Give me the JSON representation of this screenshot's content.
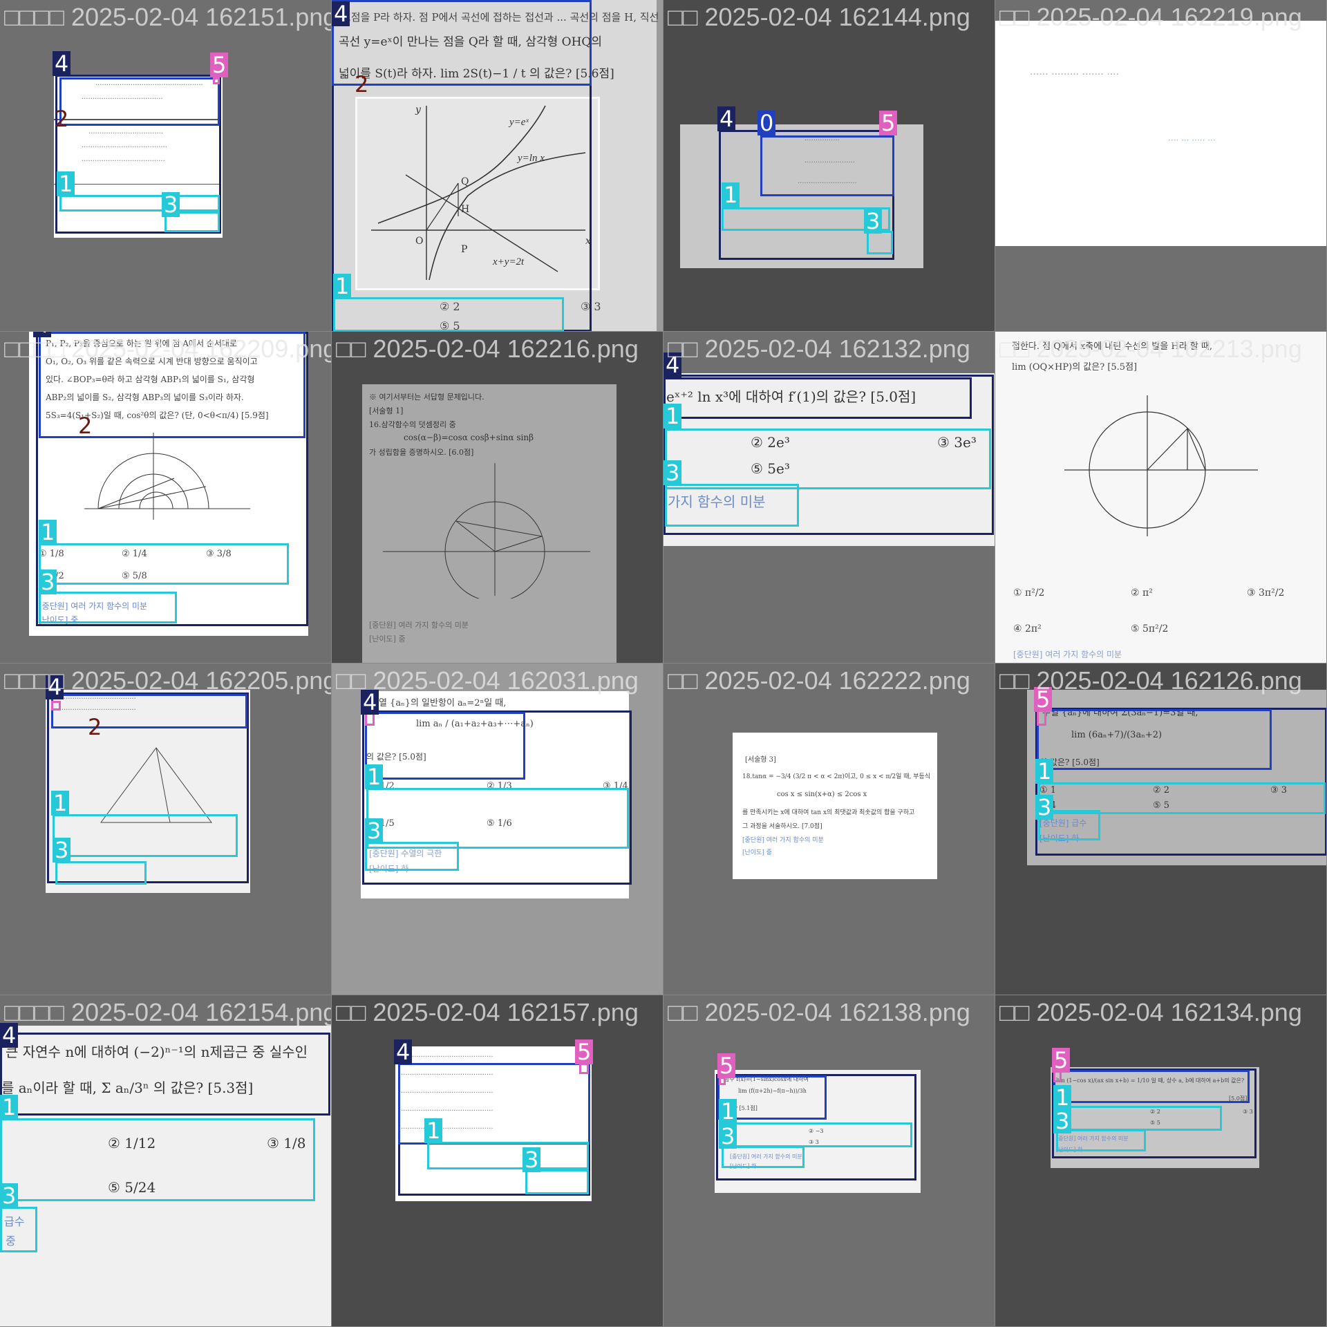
{
  "cells": [
    {
      "title": "□□□□ 2025-02-04 162151.png"
    },
    {
      "title": "",
      "lines": [
        "교점을 P라 하자. 점 P에서 곡선에 접하는 접선과 ... 곡선의 점을 H, 직선",
        "곡선 y=eˣ이 만나는 점을 Q라 할 때, 삼각형 OHQ의",
        "넓이를 S(t)라 하자. lim 2S(t)−1 / t 의 값은? [5.6점]"
      ],
      "graph": {
        "labels": [
          "y=eˣ",
          "y=ln x",
          "x+y=2t",
          "Q",
          "H",
          "O",
          "P",
          "x",
          "y"
        ]
      },
      "choices": [
        "② 2",
        "③ 3",
        "⑤ 5"
      ]
    },
    {
      "title": "□□ 2025-02-04 162144.png"
    },
    {
      "title": "□□ 2025-02-04 162219.png"
    },
    {
      "title": "□□□□ 2025-02-04 162209.png",
      "lines": [
        "P₁, P₂, P₃을 중심으로 하는 원 위에 점 A에서 순서대로",
        "O₁, O₂, O₃ 위를 같은 속력으로 시계 반대 방향으로 움직이고",
        "있다. ∠BOP₃=θ라 하고 삼각형 ABP₁의 넓이를 S₁, 삼각형",
        "ABP₂의 넓이를 S₂, 삼각형 ABP₃의 넓이를 S₃이라 하자.",
        "5S₃=4(S₁+S₂)일 때, cos²θ의 값은? (단, 0<θ<π/4) [5.9점]"
      ],
      "choices": [
        "① 1/8",
        "② 1/4",
        "③ 3/8",
        "④ 1/2",
        "⑤ 5/8"
      ],
      "meta": [
        "[중단원] 여러 가지 함수의 미분",
        "[난이도] 중"
      ]
    },
    {
      "title": "□□ 2025-02-04 162216.png",
      "lines": [
        "※ 여기서부터는 서답형 문제입니다.",
        "[서술형 1]",
        "16.삼각함수의 덧셈정리 중",
        "cos(α−β)=cosα cosβ+sinα sinβ",
        "가 성립함을 증명하시오. [6.0점]"
      ],
      "meta": [
        "[중단원] 여러 가지 함수의 미분",
        "[난이도] 중"
      ]
    },
    {
      "title": "□□ 2025-02-04 162132.png",
      "lines": [
        "eˣ⁺² ln x³에 대하여 f′(1)의 값은? [5.0점]"
      ],
      "choices": [
        "② 2e³",
        "③ 3e³",
        "⑤ 5e³"
      ],
      "meta": [
        "가지 함수의 미분"
      ]
    },
    {
      "title": "□□ 2025-02-04 162213.png",
      "lines": [
        "접한다. 점 Q에서 x축에 내린 수선의 발을 H라 할 때,",
        "lim (OQ×HP)의 값은? [5.5점]"
      ],
      "choices": [
        "① π²/2",
        "② π²",
        "③ 3π²/2",
        "④ 2π²",
        "⑤ 5π²/2"
      ],
      "meta": [
        "[중단원] 여러 가지 함수의 미분"
      ]
    },
    {
      "title": "□□□□ 2025-02-04 162205.png"
    },
    {
      "title": "□□ 2025-02-04 162031.png",
      "lines": [
        "수열 {aₙ}의 일반항이 aₙ=2ⁿ일 때,",
        "lim aₙ / (a₁+a₂+a₃+⋯+aₙ)",
        "의 값은? [5.0점]"
      ],
      "choices": [
        "① 1/2",
        "② 1/3",
        "③ 1/4",
        "④ 1/5",
        "⑤ 1/6"
      ],
      "meta": [
        "[중단원] 수열의 극한",
        "[난이도] 하"
      ]
    },
    {
      "title": "□□ 2025-02-04 162222.png",
      "lines": [
        "[서술형 3]",
        "18.tanα = −3/4 (3/2 π < α < 2π)이고, 0 ≤ x < π/2일 때, 부등식",
        "cos x ≤ sin(x+α) ≤ 2cos x",
        "를 만족시키는 x에 대하여 tan x의 최댓값과 최솟값의 합을 구하고",
        "그 과정을 서술하시오. [7.0점]"
      ],
      "meta": [
        "[중단원] 여러 가지 함수의 미분",
        "[난이도] 중"
      ]
    },
    {
      "title": "□□ 2025-02-04 162126.png",
      "lines": [
        "수열 {aₙ}에 대하여 Σ(3aₙ−1)=3일 때,",
        "lim (6aₙ+7)/(3aₙ+2)",
        "의 값은? [5.0점]"
      ],
      "choices": [
        "① 1",
        "② 2",
        "③ 3",
        "④ 4",
        "⑤ 5"
      ],
      "meta": [
        "[중단원] 급수",
        "[난이도] 하"
      ]
    },
    {
      "title": "□□□□ 2025-02-04 162154.png",
      "lines": [
        "큰 자연수 n에 대하여 (−2)ⁿ⁻¹의 n제곱근 중 실수인",
        "를 aₙ이라 할 때, Σ aₙ/3ⁿ 의 값은? [5.3점]"
      ],
      "choices": [
        "② 1/12",
        "③ 1/8",
        "⑤ 5/24"
      ],
      "meta": [
        "급수",
        "중"
      ]
    },
    {
      "title": "□□ 2025-02-04 162157.png"
    },
    {
      "title": "□□ 2025-02-04 162138.png",
      "lines": [
        "함수 f(x)=(1−sinx)cosx에 대하여",
        "lim (f(π+2h)−f(π−h))/3h",
        "값은? [5.1점]"
      ],
      "choices": [
        "5",
        "② −3",
        "③ 3"
      ],
      "meta": [
        "[중단원] 여러 가지 함수의 미분",
        "[난이도] 하"
      ]
    },
    {
      "title": "□□ 2025-02-04 162134.png",
      "lines": [
        "lim (1−cos x)/(ax sin x+b) = 1/10 일 때, 상수 a, b에 대하여 a+b의 값은?",
        "[5.0점]"
      ],
      "choices": [
        "② 2",
        "③ 3",
        "⑤ 5"
      ],
      "meta": [
        "[중단원] 여러 가지 함수의 미분",
        "[난이도] 하"
      ]
    }
  ],
  "tags": {
    "question": "4",
    "stem": "2",
    "choices": "1",
    "meta": "3",
    "number": "5",
    "zero": "0"
  }
}
